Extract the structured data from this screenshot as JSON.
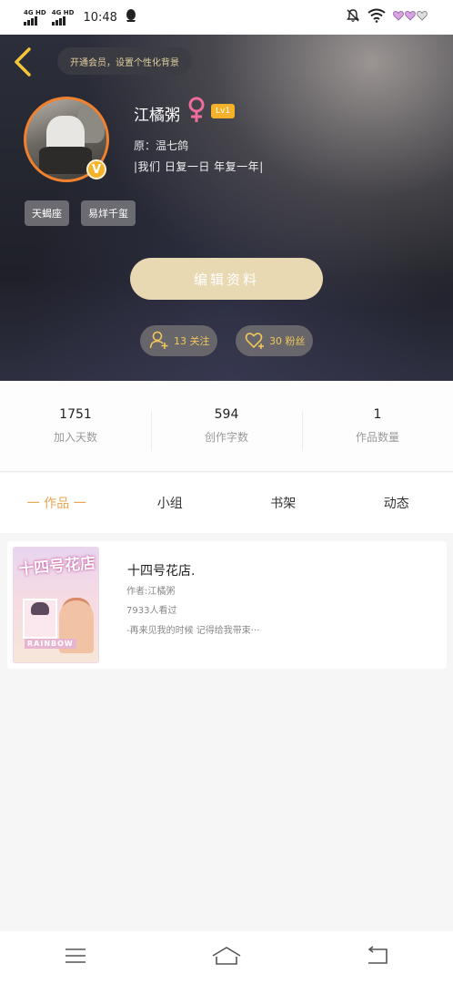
{
  "status_bar": {
    "network_1": "4G HD",
    "network_2": "4G HD",
    "time": "10:48"
  },
  "header": {
    "vip_banner": "开通会员，设置个性化背景",
    "username": "江橘粥",
    "level": "Lv1",
    "verified_badge": "V",
    "origin": "原：温七鸽",
    "bio": "我们  日复一日  年复一年",
    "tags": [
      "天蝎座",
      "易烊千玺"
    ],
    "edit_profile_label": "编辑资料",
    "follow_label": "13 关注",
    "fans_label": "30 粉丝"
  },
  "stats": [
    {
      "value": "1751",
      "label": "加入天数"
    },
    {
      "value": "594",
      "label": "创作字数"
    },
    {
      "value": "1",
      "label": "作品数量"
    }
  ],
  "tabs": [
    {
      "label": "一 作品 一",
      "active": true
    },
    {
      "label": "小组",
      "active": false
    },
    {
      "label": "书架",
      "active": false
    },
    {
      "label": "动态",
      "active": false
    }
  ],
  "works": [
    {
      "cover_title": "十四号花店",
      "cover_text": "RAINBOW",
      "title": "十四号花店.",
      "author": "作者:江橘粥",
      "views": "7933人看过",
      "excerpt": "-再来见我的时候 记得给我带束···"
    }
  ],
  "colors": {
    "accent": "#e9a653",
    "avatar_border": "#f0812f",
    "badge": "#f4b22a",
    "gender_icon": "#ee6d9d",
    "edit_button": "#e8d9b2",
    "pill_text": "#f2c65b"
  },
  "icons": {
    "back": "chevron-left-icon",
    "gender": "female-icon",
    "follow": "add-user-icon",
    "fans": "heart-icon",
    "nav_menu": "menu-icon",
    "nav_home": "home-icon",
    "nav_back": "back-icon"
  }
}
